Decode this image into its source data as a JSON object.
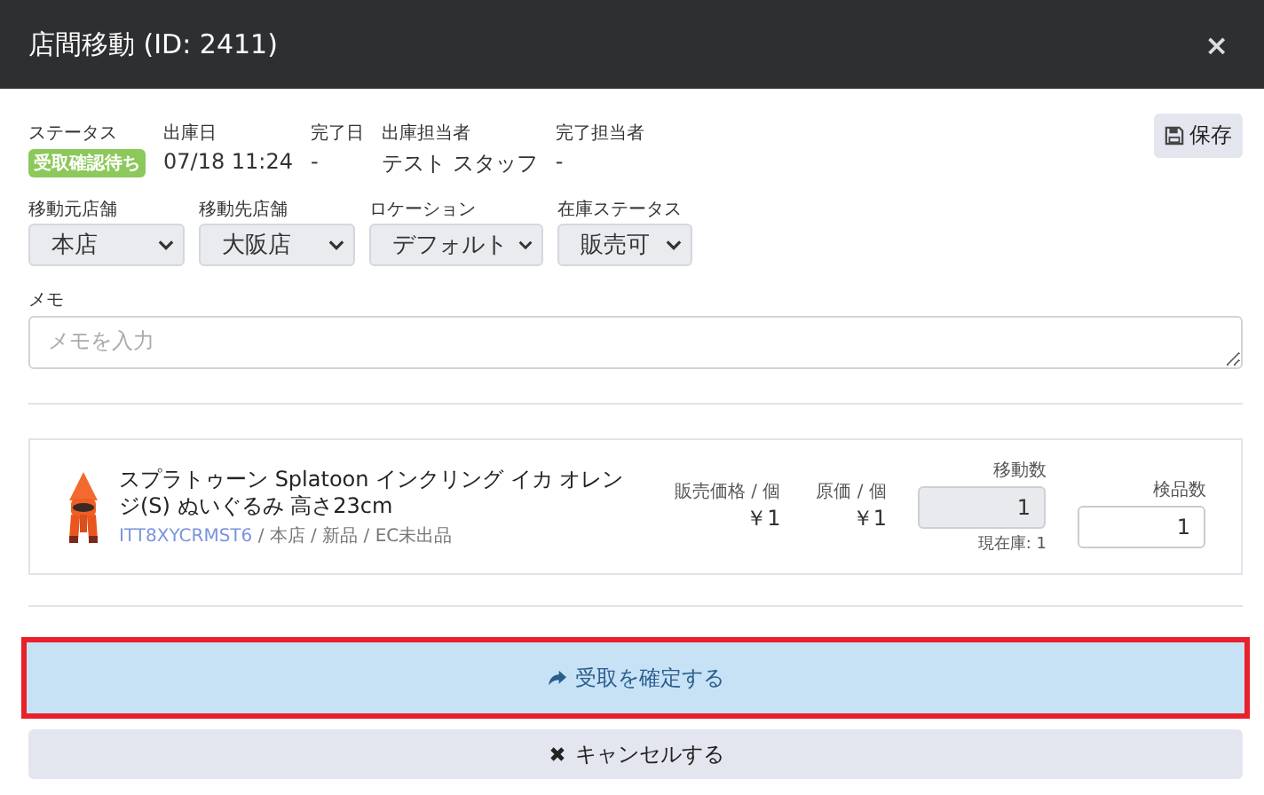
{
  "window": {
    "title": "店間移動 (ID: 2411)",
    "close": "×"
  },
  "info": [
    {
      "label": "ステータス",
      "kind": "badge",
      "value": "受取確認待ち"
    },
    {
      "label": "出庫日",
      "kind": "text",
      "value": "07/18 11:24"
    },
    {
      "label": "完了日",
      "kind": "text",
      "value": "-"
    },
    {
      "label": "出庫担当者",
      "kind": "text",
      "value": "テスト スタッフ"
    },
    {
      "label": "完了担当者",
      "kind": "text",
      "value": "-"
    }
  ],
  "save_button": "保存",
  "selects": [
    {
      "label": "移動元店舗",
      "value": "本店"
    },
    {
      "label": "移動先店舗",
      "value": "大阪店"
    },
    {
      "label": "ロケーション",
      "value": "デフォルト"
    },
    {
      "label": "在庫ステータス",
      "value": "販売可"
    }
  ],
  "memo": {
    "label": "メモ",
    "placeholder": "メモを入力"
  },
  "item": {
    "kind": "picture",
    "name": "スプラトゥーン Splatoon インクリング イカ オレンジ(S) ぬいぐるみ 高さ23cm",
    "code": "ITT8XYCRMST6",
    "meta": " / 本店 / 新品 / EC未出品",
    "price_label": "販売価格 / 個",
    "price": "￥1",
    "cost_label": "原価 / 個",
    "cost": "￥1",
    "move_label": "移動数",
    "move_qty": "1",
    "move_disabled": true,
    "stock_note": "現在庫: 1",
    "inspect_label": "検品数",
    "inspect_qty": "1"
  },
  "confirm_button": {
    "label": "受取を確定する",
    "highlighted": true
  },
  "cancel_button": {
    "label": "キャンセルする"
  }
}
